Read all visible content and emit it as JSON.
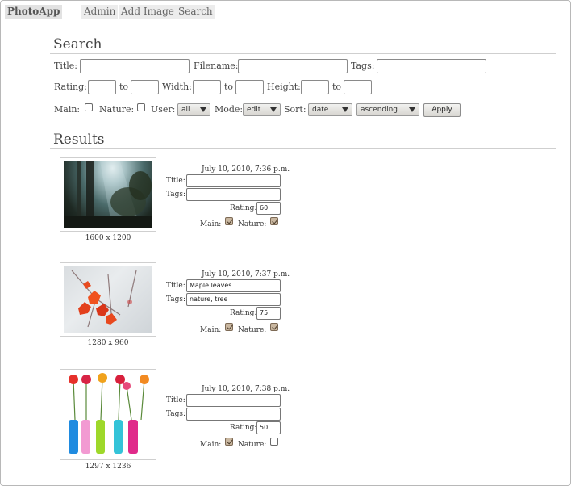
{
  "nav": {
    "brand": "PhotoApp",
    "links": [
      "Admin",
      "Add Image",
      "Search"
    ]
  },
  "search": {
    "heading": "Search",
    "title_label": "Title:",
    "filename_label": "Filename:",
    "tags_label": "Tags:",
    "rating_label": "Rating:",
    "width_label": "Width:",
    "height_label": "Height:",
    "to_label": "to",
    "main_label": "Main:",
    "nature_label": "Nature:",
    "user_label": "User:",
    "user_value": "all",
    "mode_label": "Mode:",
    "mode_value": "edit",
    "sort_label": "Sort:",
    "sort_value": "date",
    "order_value": "ascending",
    "apply_label": "Apply"
  },
  "results": {
    "heading": "Results",
    "title_label": "Title:",
    "tags_label": "Tags:",
    "rating_label": "Rating:",
    "main_label": "Main:",
    "nature_label": "Nature:",
    "items": [
      {
        "date": "July 10, 2010, 7:36 p.m.",
        "title": "",
        "tags": "",
        "rating": "60",
        "main": true,
        "nature": true,
        "dims": "1600 x 1200"
      },
      {
        "date": "July 10, 2010, 7:37 p.m.",
        "title": "Maple leaves",
        "tags": "nature, tree",
        "rating": "75",
        "main": true,
        "nature": true,
        "dims": "1280 x 960"
      },
      {
        "date": "July 10, 2010, 7:38 p.m.",
        "title": "",
        "tags": "",
        "rating": "50",
        "main": true,
        "nature": false,
        "dims": "1297 x 1236"
      }
    ]
  }
}
